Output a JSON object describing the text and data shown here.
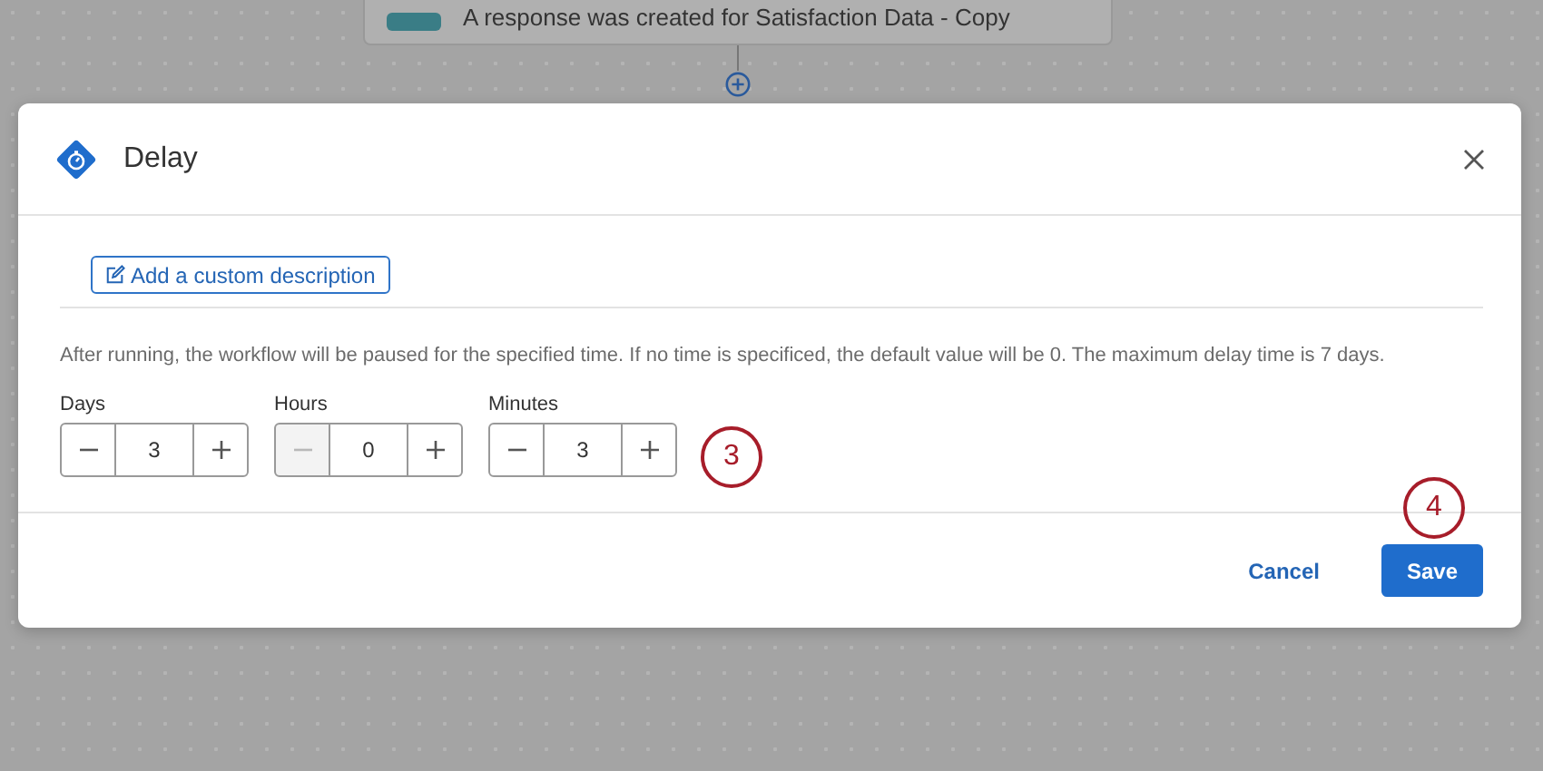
{
  "trigger_card": {
    "text": "A response was created for Satisfaction Data - Copy"
  },
  "dialog": {
    "title": "Delay",
    "description_link": "Add a custom description",
    "help_text": "After running, the workflow will be paused for the specified time. If no time is specificed, the default value will be 0. The maximum delay time is 7 days.",
    "fields": [
      {
        "label": "Days",
        "value": "3",
        "decrement_disabled": false
      },
      {
        "label": "Hours",
        "value": "0",
        "decrement_disabled": true
      },
      {
        "label": "Minutes",
        "value": "3",
        "decrement_disabled": false
      }
    ],
    "buttons": [
      {
        "label": "Cancel",
        "kind": "link"
      },
      {
        "label": "Save",
        "kind": "primary"
      }
    ]
  },
  "callouts": [
    {
      "label": "3",
      "kind": "fields"
    },
    {
      "label": "4",
      "kind": "save"
    }
  ]
}
